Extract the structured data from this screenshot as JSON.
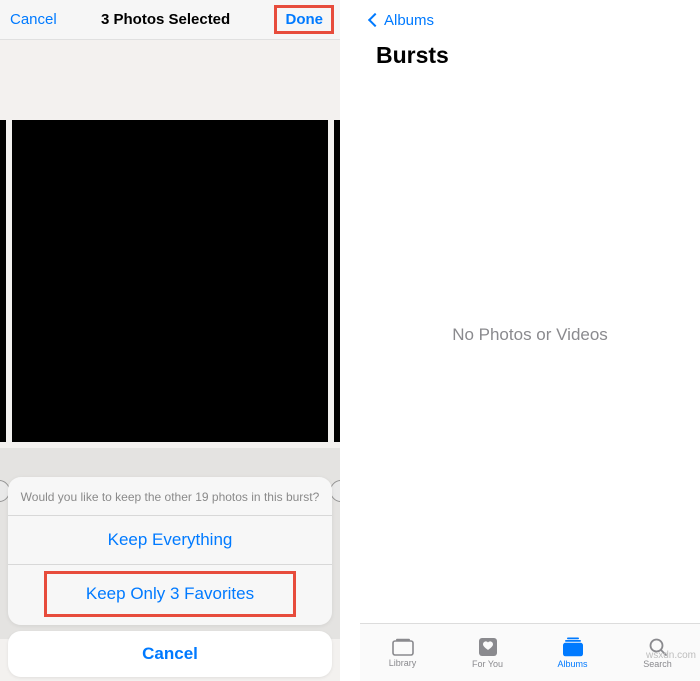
{
  "left": {
    "nav": {
      "cancel": "Cancel",
      "title": "3 Photos Selected",
      "done": "Done"
    },
    "sheet": {
      "message": "Would you like to keep the other 19 photos in this burst?",
      "keep_all": "Keep Everything",
      "keep_fav": "Keep Only 3 Favorites",
      "cancel": "Cancel"
    }
  },
  "right": {
    "back": "Albums",
    "title": "Bursts",
    "empty": "No Photos or Videos",
    "tabs": {
      "library": "Library",
      "foryou": "For You",
      "albums": "Albums",
      "search": "Search"
    }
  },
  "watermark": "wsxdn.com"
}
